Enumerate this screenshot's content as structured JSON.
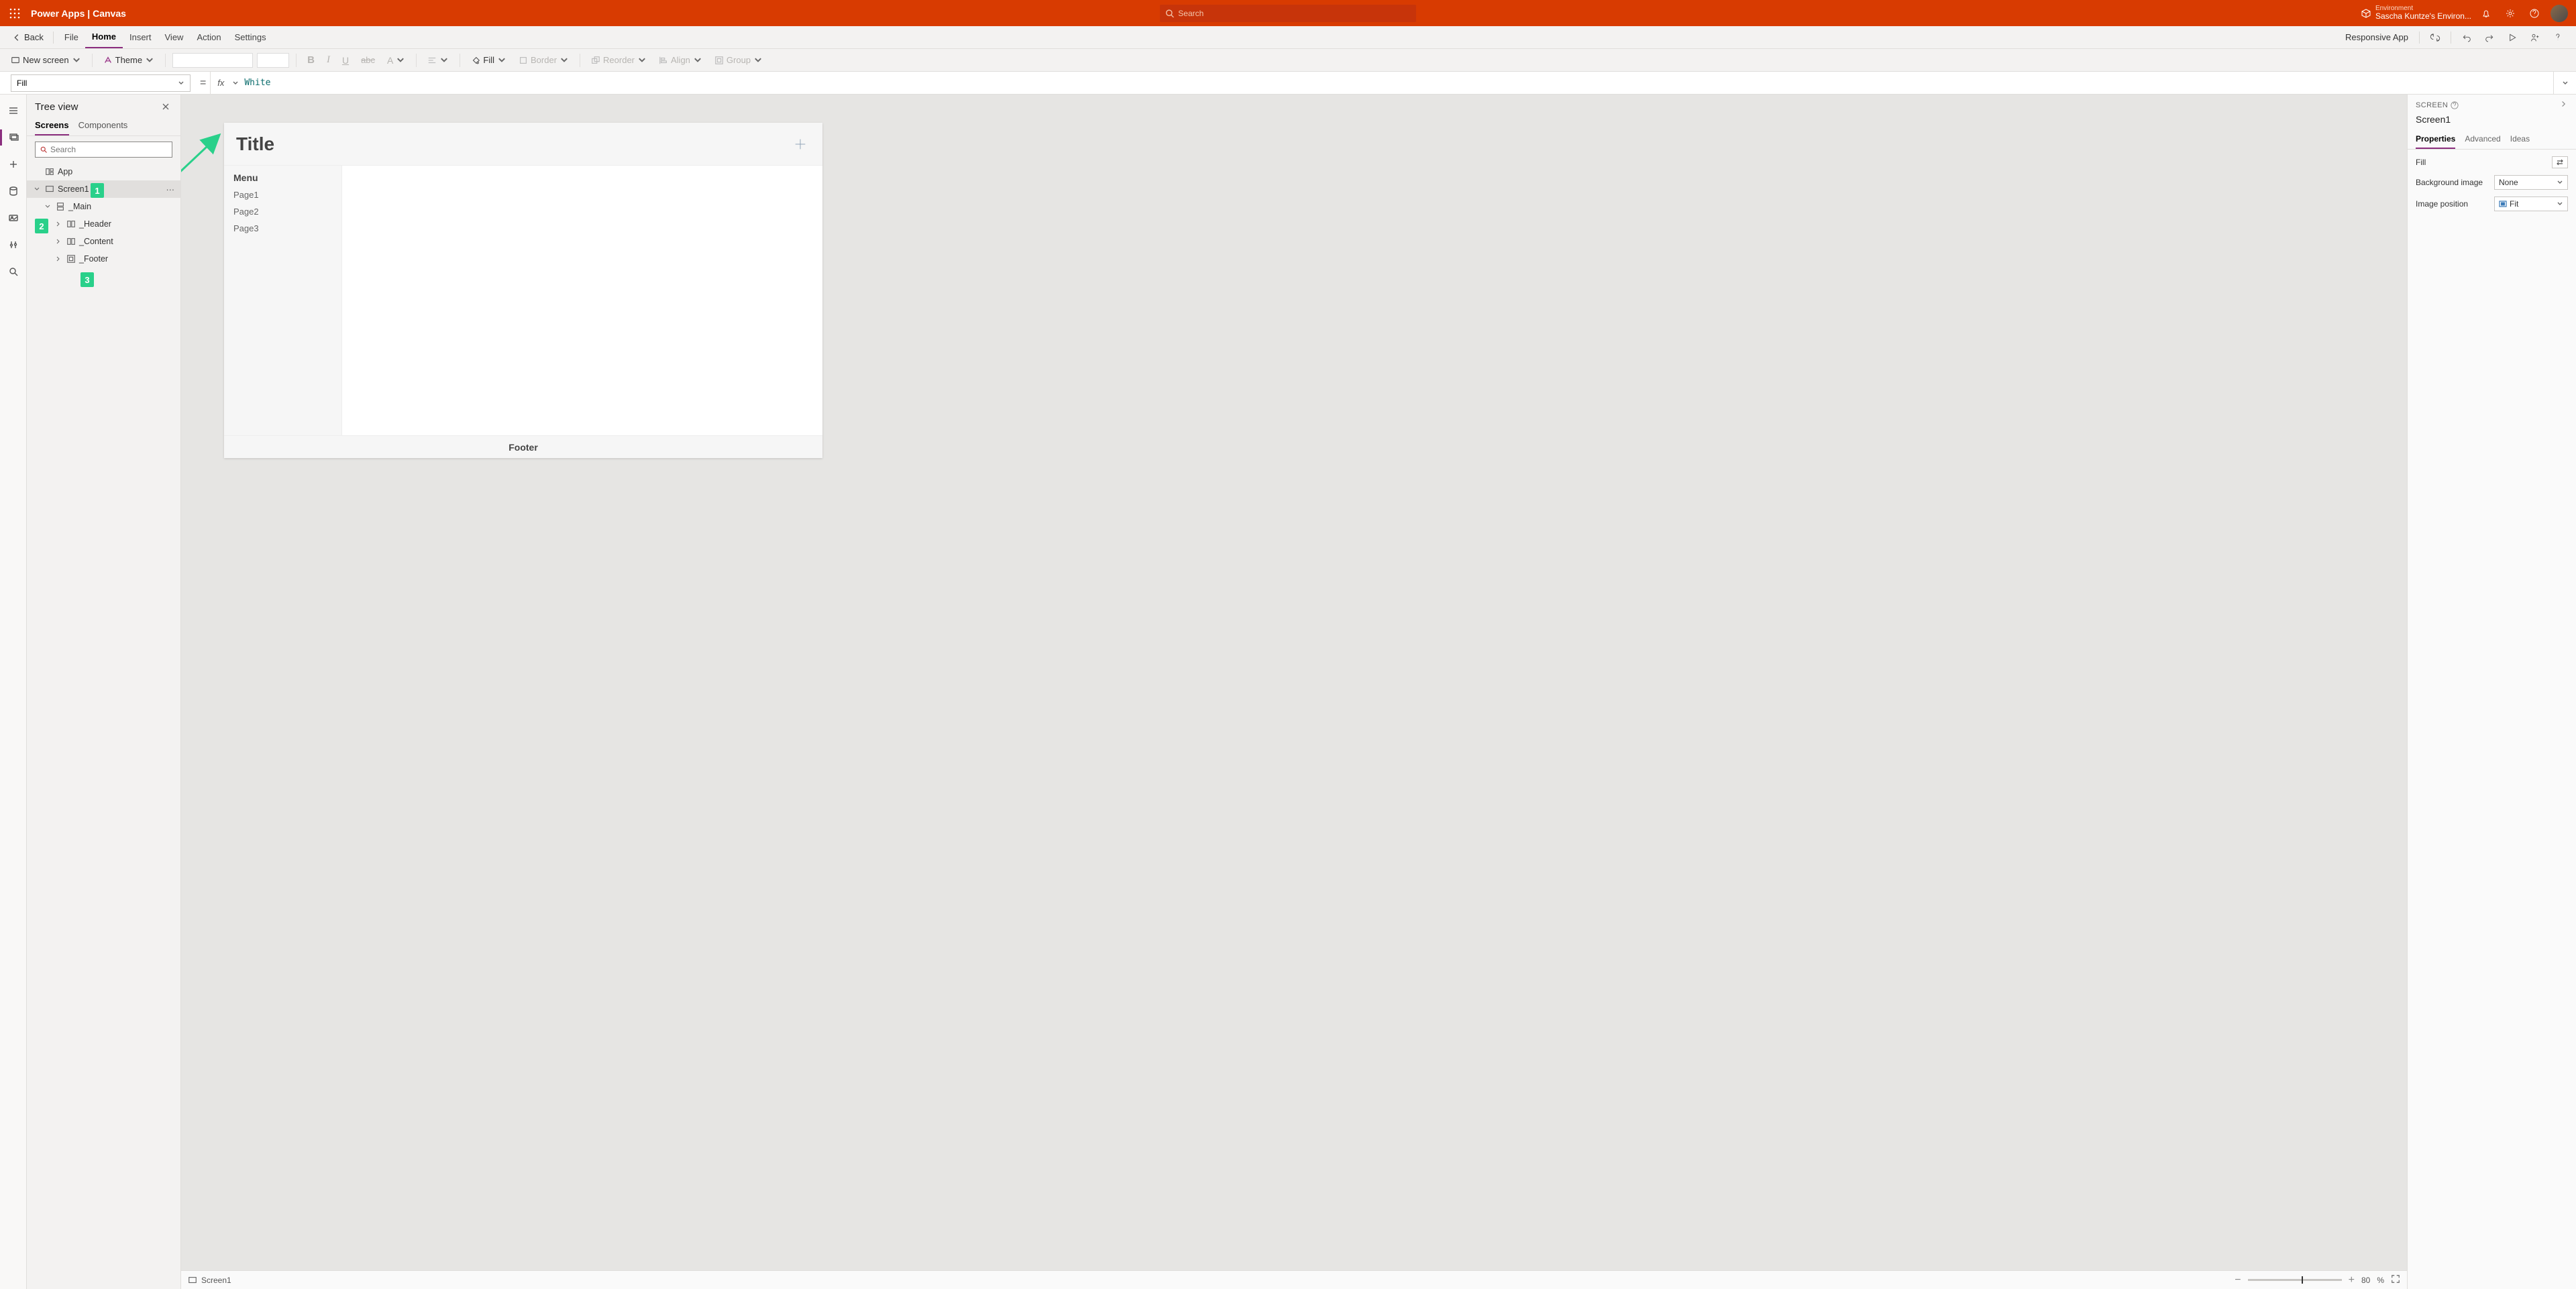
{
  "topbar": {
    "app_title": "Power Apps  |  Canvas",
    "search_placeholder": "Search",
    "env_label": "Environment",
    "env_name": "Sascha Kuntze's Environ..."
  },
  "menubar": {
    "back": "Back",
    "items": [
      "File",
      "Home",
      "Insert",
      "View",
      "Action",
      "Settings"
    ],
    "active_index": 1,
    "responsive": "Responsive App"
  },
  "toolbar": {
    "new_screen": "New screen",
    "theme": "Theme",
    "fill": "Fill",
    "border": "Border",
    "reorder": "Reorder",
    "align": "Align",
    "group": "Group"
  },
  "formula": {
    "property": "Fill",
    "fx": "fx",
    "value": "White"
  },
  "tree": {
    "title": "Tree view",
    "tabs": [
      "Screens",
      "Components"
    ],
    "active_tab": 0,
    "search_placeholder": "Search",
    "app": "App",
    "screen": "Screen1",
    "main": "_Main",
    "header": "_Header",
    "content": "_Content",
    "footer": "_Footer"
  },
  "canvas": {
    "title": "Title",
    "menu_label": "Menu",
    "pages": [
      "Page1",
      "Page2",
      "Page3"
    ],
    "footer": "Footer"
  },
  "annotations": {
    "n1": "1",
    "n2": "2",
    "n3": "3"
  },
  "status": {
    "screen": "Screen1",
    "zoom_value": "80",
    "zoom_unit": "%"
  },
  "props": {
    "section": "SCREEN",
    "name": "Screen1",
    "tabs": [
      "Properties",
      "Advanced",
      "Ideas"
    ],
    "active_tab": 0,
    "fill_label": "Fill",
    "bg_label": "Background image",
    "bg_value": "None",
    "imgpos_label": "Image position",
    "imgpos_value": "Fit"
  }
}
